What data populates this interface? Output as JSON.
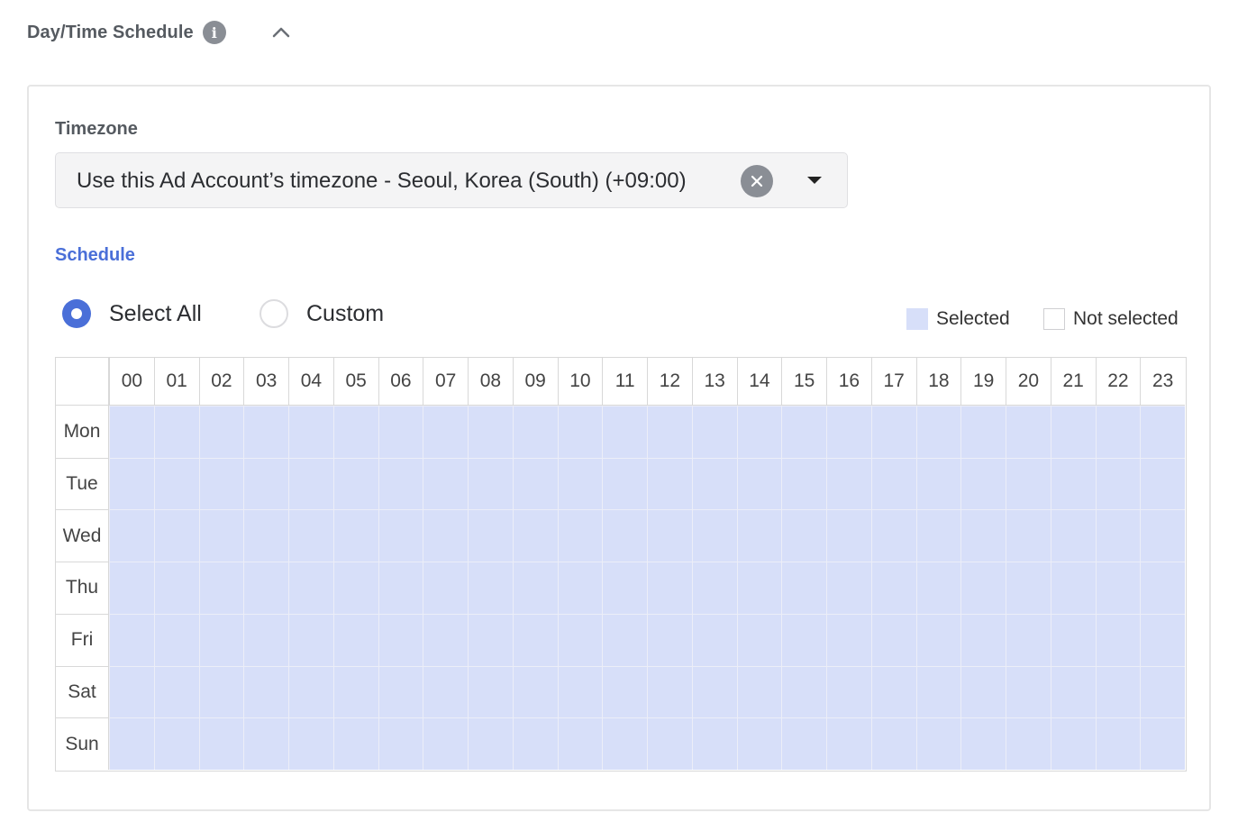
{
  "header": {
    "title": "Day/Time Schedule",
    "info_glyph": "i"
  },
  "timezone": {
    "label": "Timezone",
    "value": "Use this Ad Account’s timezone - Seoul, Korea (South) (+09:00)"
  },
  "schedule": {
    "label": "Schedule",
    "options": [
      {
        "label": "Select All",
        "checked": true
      },
      {
        "label": "Custom",
        "checked": false
      }
    ],
    "legend": {
      "selected": "Selected",
      "not_selected": "Not selected"
    },
    "hours": [
      "00",
      "01",
      "02",
      "03",
      "04",
      "05",
      "06",
      "07",
      "08",
      "09",
      "10",
      "11",
      "12",
      "13",
      "14",
      "15",
      "16",
      "17",
      "18",
      "19",
      "20",
      "21",
      "22",
      "23"
    ],
    "days": [
      "Mon",
      "Tue",
      "Wed",
      "Thu",
      "Fri",
      "Sat",
      "Sun"
    ],
    "all_cells_selected": true
  },
  "colors": {
    "accent": "#4a6fd8",
    "cell_selected": "#d7dff9",
    "cell_selected_border": "#eceef8",
    "cell_unselected": "#ffffff",
    "grid_border": "#d8d8d8"
  },
  "icons": {
    "info": "info-icon",
    "collapse": "chevron-up-icon",
    "clear": "clear-icon",
    "dropdown": "caret-down-icon"
  }
}
